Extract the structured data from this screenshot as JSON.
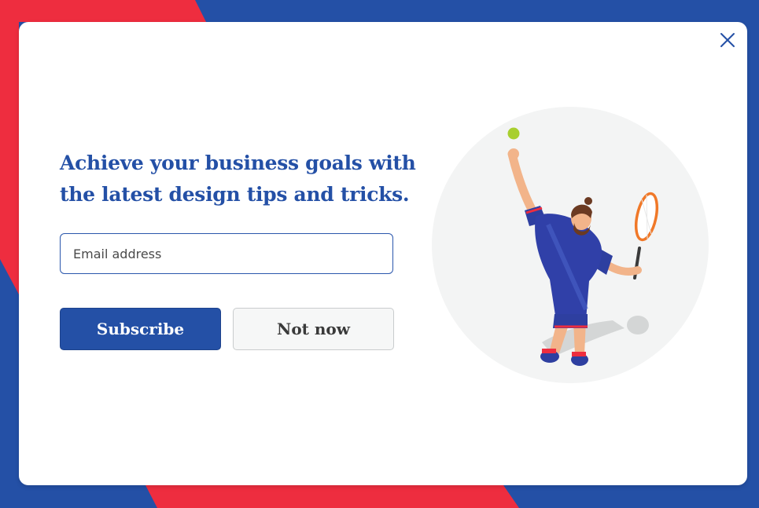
{
  "modal": {
    "headline": "Achieve your business goals with the latest design tips and tricks.",
    "email_placeholder": "Email address",
    "email_value": "",
    "subscribe_label": "Subscribe",
    "not_now_label": "Not now"
  },
  "icons": {
    "close": "close-icon",
    "illustration": "tennis-player-illustration"
  },
  "colors": {
    "brand_blue": "#2450a6",
    "accent_red": "#ee2d3f",
    "modal_bg": "#ffffff",
    "secondary_button_bg": "#f6f7f7",
    "illustration_circle": "#f3f4f4",
    "ball": "#a8cf2e"
  }
}
